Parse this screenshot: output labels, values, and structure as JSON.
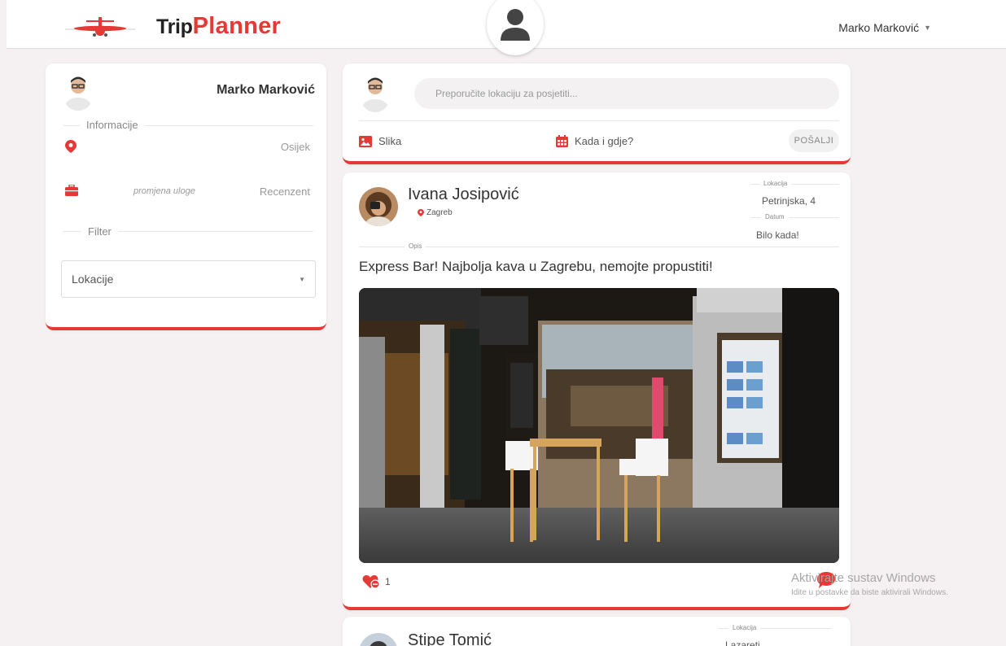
{
  "header": {
    "brand_trip": "Trip",
    "brand_planner": "Planner",
    "user_name": "Marko Marković"
  },
  "profile": {
    "name": "Marko Marković",
    "info_legend": "Informacije",
    "city": "Osijek",
    "role_change": "promjena uloge",
    "role": "Recenzent",
    "filter_legend": "Filter",
    "filter_select_value": "Lokacije"
  },
  "post_form": {
    "placeholder": "Preporučite lokaciju za posjetiti...",
    "image_btn": "Slika",
    "when_where_btn": "Kada i gdje?",
    "send_btn": "POŠALJI"
  },
  "posts": [
    {
      "author": "Ivana Josipović",
      "author_city": "Zagreb",
      "location_label": "Lokacija",
      "location": "Petrinjska, 4",
      "date_label": "Datum",
      "date": "Bilo kada!",
      "desc_label": "Opis",
      "description": "Express Bar! Najbolja kava u Zagrebu, nemojte propustiti!",
      "likes": "1"
    },
    {
      "author": "Stipe Tomić",
      "location_label": "Lokacija",
      "location": "Lazareti"
    }
  ],
  "watermark": {
    "line1": "Aktivirajte sustav Windows",
    "line2": "Idite u postavke da biste aktivirali Windows."
  },
  "colors": {
    "accent": "#e53935",
    "background": "#f5f0f1"
  }
}
